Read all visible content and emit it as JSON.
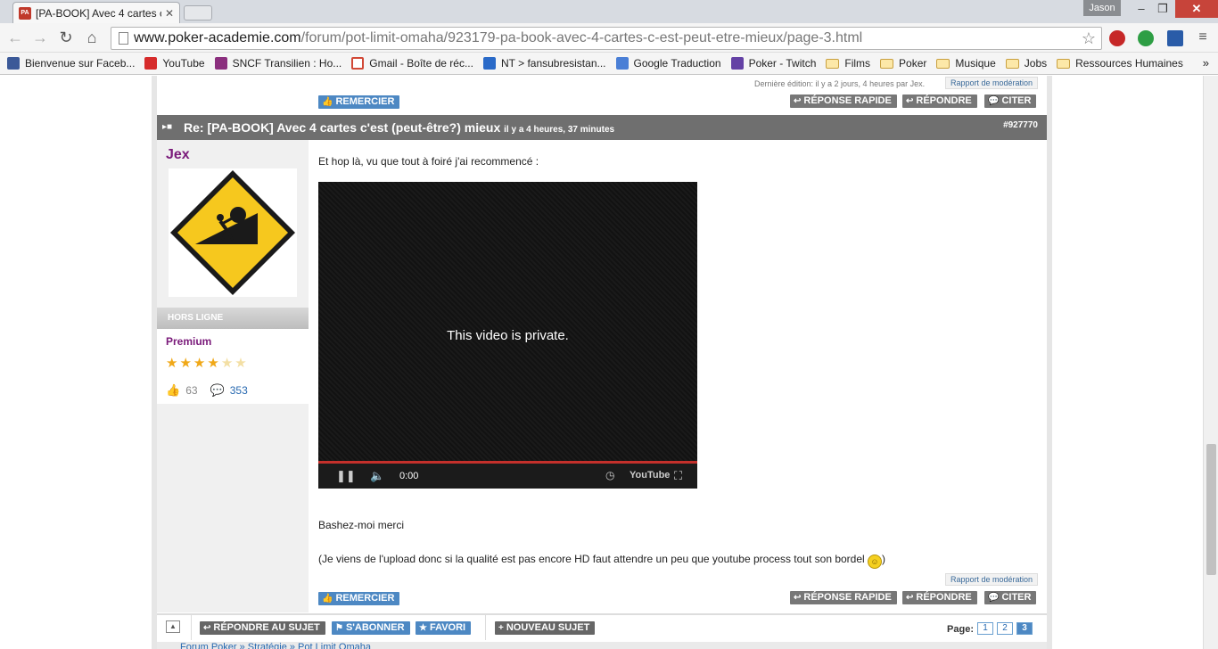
{
  "browser": {
    "tab_title": "[PA-BOOK] Avec 4 cartes c",
    "tab_favicon": "PA",
    "user_badge": "Jason",
    "url_domain": "www.poker-academie.com",
    "url_path": "/forum/pot-limit-omaha/923179-pa-book-avec-4-cartes-c-est-peut-etre-mieux/page-3.html",
    "bookmarks": [
      {
        "label": "Bienvenue sur Faceb...",
        "icon": "facebook-icon",
        "color": "#3b5998"
      },
      {
        "label": "YouTube",
        "icon": "youtube-icon",
        "color": "#d62b2b"
      },
      {
        "label": "SNCF Transilien : Ho...",
        "icon": "sncf-icon",
        "color": "#8b2f7e"
      },
      {
        "label": "Gmail - Boîte de réc...",
        "icon": "gmail-icon",
        "color": "#d14836"
      },
      {
        "label": "NT > fansubresistan...",
        "icon": "nt-icon",
        "color": "#2a6ac8"
      },
      {
        "label": "Google Traduction",
        "icon": "google-translate-icon",
        "color": "#4a7fd6"
      },
      {
        "label": "Poker - Twitch",
        "icon": "twitch-icon",
        "color": "#6441a5"
      },
      {
        "label": "Films",
        "icon": "folder-icon"
      },
      {
        "label": "Poker",
        "icon": "folder-icon"
      },
      {
        "label": "Musique",
        "icon": "folder-icon"
      },
      {
        "label": "Jobs",
        "icon": "folder-icon"
      },
      {
        "label": "Ressources Humaines",
        "icon": "folder-icon"
      }
    ],
    "bookmarks_more": "»"
  },
  "prev_post": {
    "edit_note": "Dernière édition: il y a 2 jours, 4 heures par Jex.",
    "report_label": "Rapport de modération",
    "thank_label": "REMERCIER",
    "quick_reply_label": "RÉPONSE RAPIDE",
    "reply_label": "RÉPONDRE",
    "quote_label": "CITER"
  },
  "post": {
    "title": "Re: [PA-BOOK] Avec 4 cartes c'est (peut-être?) mieux",
    "time": "il y a 4 heures, 37 minutes",
    "id": "#927770",
    "author": {
      "name": "Jex",
      "status": "HORS LIGNE",
      "rank": "Premium",
      "stars_filled": 4,
      "stars_total": 6,
      "likes": "63",
      "messages": "353"
    },
    "intro": "Et hop là, vu que tout à foiré j'ai recommencé :",
    "video": {
      "message": "This video is private.",
      "time": "0:00",
      "brand": "YouTube"
    },
    "line1": "Bashez-moi merci",
    "line2": "(Je viens de l'upload donc si la qualité est pas encore HD faut attendre un peu que youtube process tout son bordel",
    "line2_end": ")",
    "report_label": "Rapport de modération",
    "thank_label": "REMERCIER",
    "quick_reply_label": "RÉPONSE RAPIDE",
    "reply_label": "RÉPONDRE",
    "quote_label": "CITER"
  },
  "footer": {
    "reply_topic_label": "RÉPONDRE AU SUJET",
    "subscribe_label": "S'ABONNER",
    "favorite_label": "FAVORI",
    "new_topic_label": "NOUVEAU SUJET",
    "page_label": "Page:",
    "pages": [
      "1",
      "2",
      "3"
    ],
    "current_page": "3"
  },
  "breadcrumb": "Forum Poker » Stratégie » Pot Limit Omaha"
}
